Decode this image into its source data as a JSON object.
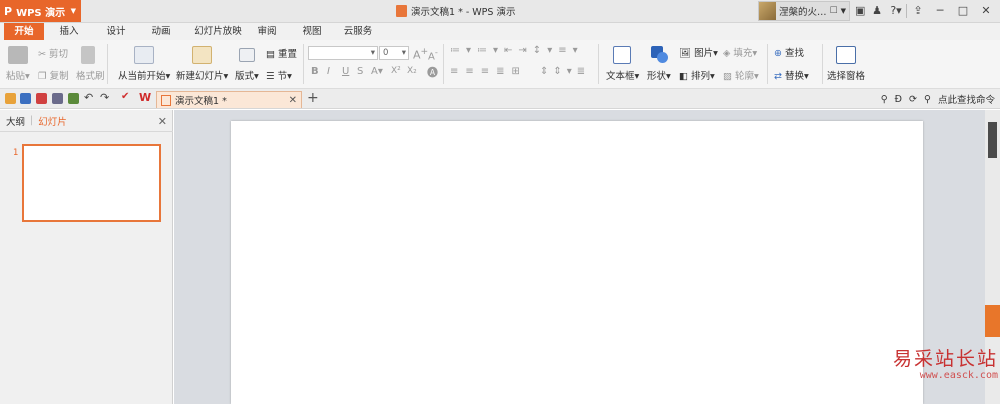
{
  "app": {
    "name": "WPS 演示",
    "window_title": "演示文稿1 * - WPS 演示",
    "user_name": "涅槃的火…"
  },
  "colors": {
    "accent": "#e8662a",
    "active_tab_text": "#ffffff",
    "workspace_bg": "#d9dce1",
    "watermark": "#c83232"
  },
  "tabs": [
    "开始",
    "插入",
    "设计",
    "动画",
    "幻灯片放映",
    "审阅",
    "视图",
    "云服务"
  ],
  "active_tab": "开始",
  "ribbon": {
    "paste": "粘贴",
    "cut": "剪切",
    "copy": "复制",
    "format_painter": "格式刷",
    "from_current": "从当前开始",
    "new_slide": "新建幻灯片",
    "layout": "版式",
    "reset": "重置",
    "section": "节",
    "font_size_value": "0",
    "text_box": "文本框",
    "shape": "形状",
    "picture": "图片",
    "fill": "填充",
    "arrange": "排列",
    "outline": "轮廓",
    "find": "查找",
    "replace": "替换",
    "selection_pane": "选择窗格",
    "bold": "B",
    "italic": "I",
    "underline": "U",
    "strike": "S",
    "font_color": "A",
    "superscript": "X²",
    "subscript": "X₂",
    "grow_font": "A",
    "shrink_font": "A"
  },
  "document_tab": {
    "title": "演示文稿1 *"
  },
  "search": {
    "label": "点此查找命令"
  },
  "side_panel": {
    "tab_outline": "大纲",
    "tab_slides": "幻灯片",
    "slide_number": "1"
  },
  "watermark": {
    "title": "易采站长站",
    "url": "www.easck.com"
  }
}
